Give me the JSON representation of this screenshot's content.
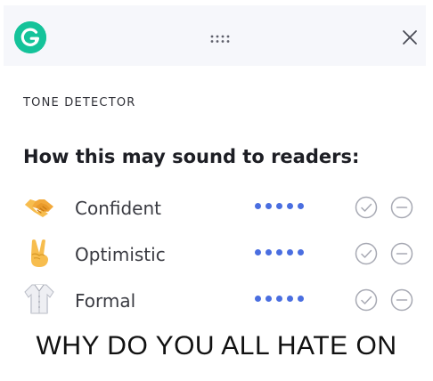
{
  "header": {
    "logo_letter": "G",
    "logo_color": "#15c39a",
    "drag_icon": "drag-handle-icon",
    "close_icon": "close-icon"
  },
  "panel": {
    "section_label": "TONE DETECTOR",
    "headline": "How this may sound to readers:",
    "tones": [
      {
        "emoji_icon": "handshake-icon",
        "label": "Confident",
        "intensity_dots": 5
      },
      {
        "emoji_icon": "victory-hand-icon",
        "label": "Optimistic",
        "intensity_dots": 5
      },
      {
        "emoji_icon": "formal-shirt-icon",
        "label": "Formal",
        "intensity_dots": 5
      }
    ],
    "agree_icon": "check-circle-icon",
    "disagree_icon": "minus-circle-icon",
    "dot_color": "#4a6ee0"
  },
  "caption": {
    "text": "WHY DO YOU ALL HATE ON"
  }
}
